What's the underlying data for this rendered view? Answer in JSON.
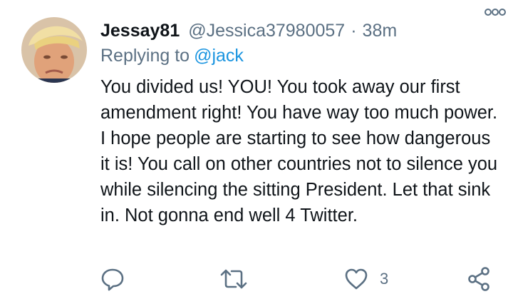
{
  "tweet": {
    "display_name": "Jessay81",
    "handle": "@Jessica37980057",
    "separator": "·",
    "time": "38m",
    "replying_prefix": "Replying to",
    "replying_handle": "@jack",
    "text": "You divided us! YOU! You took away our first amendment right! You have way too much power. I hope people are starting to see how dangerous it is! You call on other countries not to silence you while silencing the sitting President. Let that sink in. Not gonna end well 4 Twitter."
  },
  "actions": {
    "reply_icon": "reply-icon",
    "retweet_icon": "retweet-icon",
    "like_icon": "heart-icon",
    "like_count": "3",
    "share_icon": "share-icon"
  },
  "colors": {
    "text": "#0f1419",
    "secondary": "#5b7083",
    "link": "#1b95e0"
  }
}
